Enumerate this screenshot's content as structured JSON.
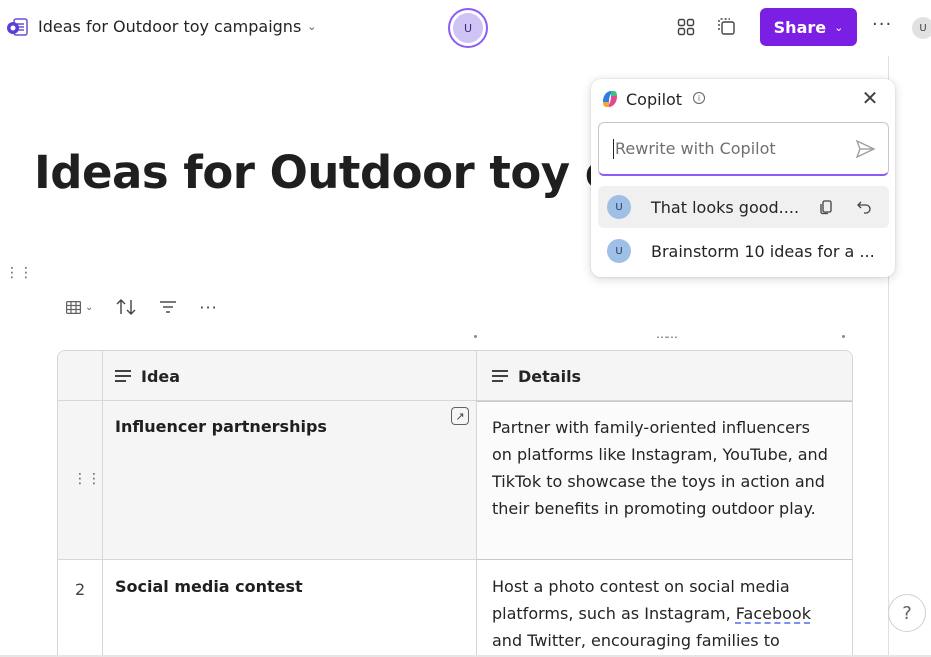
{
  "header": {
    "doc_title": "Ideas for Outdoor toy campaigns",
    "center_avatar": "U",
    "share_label": "Share",
    "more_label": "···",
    "right_avatar": "U"
  },
  "page": {
    "heading": "Ideas for Outdoor toy ca"
  },
  "table": {
    "columns": [
      {
        "label": "Idea"
      },
      {
        "label": "Details"
      }
    ],
    "rows": [
      {
        "number": "",
        "idea": "Influencer partnerships",
        "details": "Partner with family-oriented influencers on platforms like Instagram, YouTube, and TikTok to showcase the toys in action and their benefits in promoting outdoor play."
      },
      {
        "number": "2",
        "idea": "Social media contest",
        "details_before": "Host a photo contest on social media platforms, such as Instagram, ",
        "details_flagged": "Facebook",
        "details_after": " and Twitter, encouraging families to"
      }
    ]
  },
  "copilot": {
    "title": "Copilot",
    "placeholder": "Rewrite with Copilot",
    "history": [
      {
        "avatar": "U",
        "text": "That looks good...."
      },
      {
        "avatar": "U",
        "text": "Brainstorm 10 ideas for a ..."
      }
    ]
  },
  "help_label": "?",
  "colors": {
    "accent": "#7b1fe4",
    "focus_border": "#8b5cf6",
    "header_bg": "#f5f5f5"
  }
}
